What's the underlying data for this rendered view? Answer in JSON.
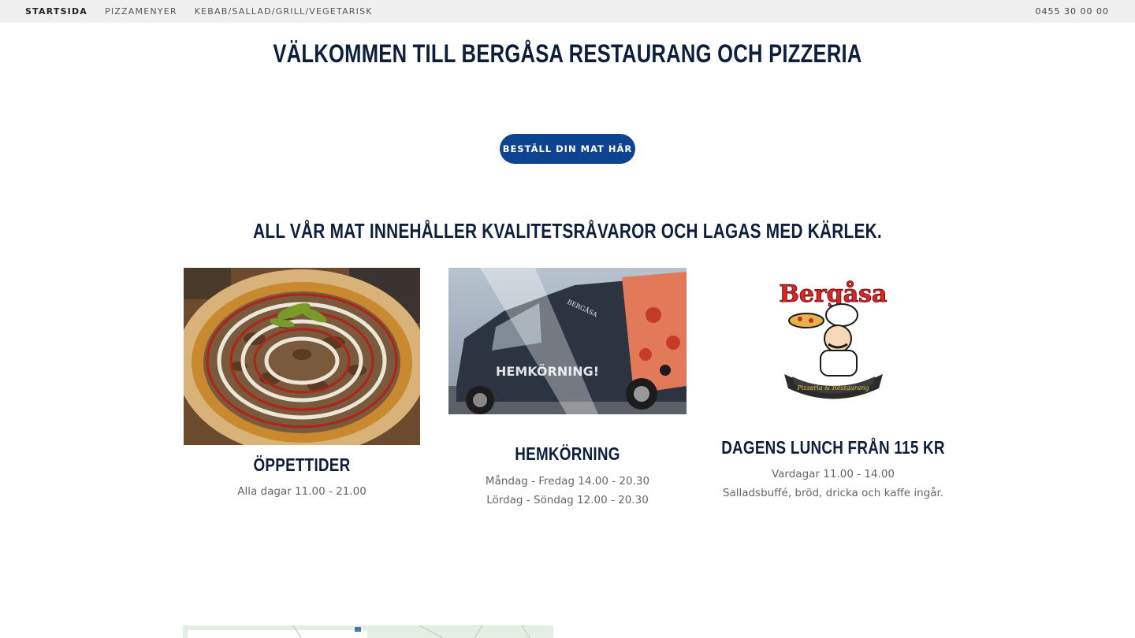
{
  "nav": {
    "items": [
      {
        "label": "STARTSIDA",
        "active": true
      },
      {
        "label": "PIZZAMENYER",
        "active": false
      },
      {
        "label": "KEBAB/SALLAD/GRILL/VEGETARISK",
        "active": false
      }
    ],
    "phone": "0455 30 00 00"
  },
  "hero": {
    "title": "VÄLKOMMEN TILL BERGÅSA RESTAURANG OCH PIZZERIA",
    "cta_label": "BESTÄLL DIN MAT HÄR"
  },
  "section": {
    "title": "ALL VÅR MAT INNEHÅLLER KVALITETSRÅVAROR OCH LAGAS MED KÄRLEK."
  },
  "columns": [
    {
      "title": "ÖPPETTIDER",
      "lines": [
        "Alla dagar 11.00 - 21.00"
      ]
    },
    {
      "title": "HEMKÖRNING",
      "lines": [
        "Måndag - Fredag  14.00 - 20.30",
        "Lördag - Söndag  12.00 - 20.30"
      ]
    },
    {
      "title": "DAGENS LUNCH FRÅN 115 KR",
      "lines": [
        "Vardagar 11.00 - 14.00",
        "Salladsbuffé, bröd, dricka och kaffe ingår."
      ]
    }
  ],
  "van": {
    "side_text": "HEMKÖRNING!",
    "brand": "BERGÅSA"
  },
  "logo": {
    "wordmark": "Bergåsa",
    "ribbon": "Pizzeria & Restaurang"
  },
  "colors": {
    "accent": "#0d4391",
    "heading": "#0d1f3c",
    "topbar": "#f0f0f0"
  }
}
